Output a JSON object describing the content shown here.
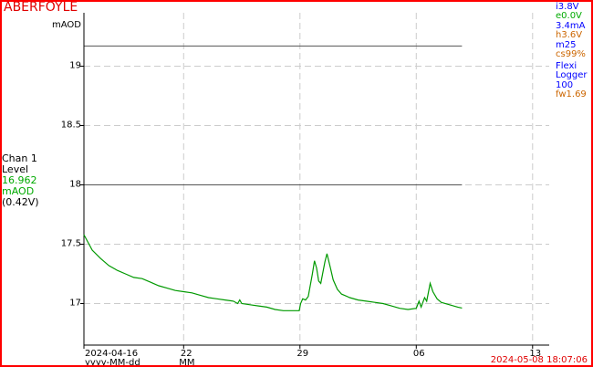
{
  "header": {
    "site_name": "ABERFOYLE"
  },
  "channel": {
    "name": "Chan 1",
    "param": "Level",
    "value": "16.962",
    "unit": "mAOD",
    "raw": "(0.42V)",
    "value_color": "#00aa00"
  },
  "status": [
    {
      "text": "i3.8V",
      "color": "#0000ff"
    },
    {
      "text": "e0.0V",
      "color": "#00aa00"
    },
    {
      "text": "3.4mA",
      "color": "#0000ff"
    },
    {
      "text": "h3.6V",
      "color": "#cc6600"
    },
    {
      "text": "m25",
      "color": "#0000ff"
    },
    {
      "text": "cs99%",
      "color": "#cc6600"
    }
  ],
  "logger": {
    "line1": "Flexi",
    "line2": "Logger",
    "line3": "100",
    "firmware": "fw1.69",
    "firmware_color": "#cc6600"
  },
  "timestamp": "2024-05-08 18:07:06",
  "chart_data": {
    "type": "line",
    "y_unit_label": "mAOD",
    "ylim": [
      16.65,
      19.45
    ],
    "y_ticks": [
      17,
      17.5,
      18,
      18.5,
      19
    ],
    "y_tick_labels": [
      "17",
      "17.5",
      "18",
      "18.5",
      "19"
    ],
    "xlim": [
      "2024-04-16",
      "2024-05-14"
    ],
    "x_ticks": [
      "2024-04-16",
      "2024-04-22",
      "2024-04-29",
      "2024-05-06",
      "2024-05-13"
    ],
    "x_tick_labels": [
      "2024-04-16",
      "22",
      "29",
      "06",
      "13"
    ],
    "x_format_labels": [
      "yyyy-MM-dd",
      "MM"
    ],
    "grid": true,
    "threshold_lines": [
      19.17,
      18.0
    ],
    "series": [
      {
        "color": "#009900",
        "points": [
          [
            "2024-04-16 00:00",
            17.58
          ],
          [
            "2024-04-16 12:00",
            17.45
          ],
          [
            "2024-04-17 00:00",
            17.38
          ],
          [
            "2024-04-17 12:00",
            17.32
          ],
          [
            "2024-04-18 00:00",
            17.28
          ],
          [
            "2024-04-18 12:00",
            17.25
          ],
          [
            "2024-04-19 00:00",
            17.22
          ],
          [
            "2024-04-19 12:00",
            17.21
          ],
          [
            "2024-04-20 00:00",
            17.18
          ],
          [
            "2024-04-20 12:00",
            17.15
          ],
          [
            "2024-04-21 00:00",
            17.13
          ],
          [
            "2024-04-21 12:00",
            17.11
          ],
          [
            "2024-04-22 00:00",
            17.1
          ],
          [
            "2024-04-22 12:00",
            17.09
          ],
          [
            "2024-04-23 00:00",
            17.07
          ],
          [
            "2024-04-23 12:00",
            17.05
          ],
          [
            "2024-04-24 00:00",
            17.04
          ],
          [
            "2024-04-24 12:00",
            17.03
          ],
          [
            "2024-04-25 00:00",
            17.02
          ],
          [
            "2024-04-25 06:00",
            17.0
          ],
          [
            "2024-04-25 09:00",
            17.03
          ],
          [
            "2024-04-25 12:00",
            17.0
          ],
          [
            "2024-04-26 00:00",
            16.99
          ],
          [
            "2024-04-26 12:00",
            16.98
          ],
          [
            "2024-04-27 00:00",
            16.97
          ],
          [
            "2024-04-27 12:00",
            16.95
          ],
          [
            "2024-04-28 00:00",
            16.94
          ],
          [
            "2024-04-28 12:00",
            16.94
          ],
          [
            "2024-04-28 23:00",
            16.94
          ],
          [
            "2024-04-29 01:00",
            17.0
          ],
          [
            "2024-04-29 04:00",
            17.04
          ],
          [
            "2024-04-29 08:00",
            17.03
          ],
          [
            "2024-04-29 12:00",
            17.06
          ],
          [
            "2024-04-29 18:00",
            17.25
          ],
          [
            "2024-04-29 21:00",
            17.36
          ],
          [
            "2024-04-30 00:00",
            17.3
          ],
          [
            "2024-04-30 03:00",
            17.19
          ],
          [
            "2024-04-30 06:00",
            17.17
          ],
          [
            "2024-04-30 12:00",
            17.35
          ],
          [
            "2024-04-30 15:00",
            17.42
          ],
          [
            "2024-04-30 20:00",
            17.3
          ],
          [
            "2024-05-01 00:00",
            17.2
          ],
          [
            "2024-05-01 06:00",
            17.12
          ],
          [
            "2024-05-01 12:00",
            17.08
          ],
          [
            "2024-05-02 00:00",
            17.05
          ],
          [
            "2024-05-02 12:00",
            17.03
          ],
          [
            "2024-05-03 00:00",
            17.02
          ],
          [
            "2024-05-03 12:00",
            17.01
          ],
          [
            "2024-05-04 00:00",
            17.0
          ],
          [
            "2024-05-04 12:00",
            16.98
          ],
          [
            "2024-05-05 00:00",
            16.96
          ],
          [
            "2024-05-05 12:00",
            16.95
          ],
          [
            "2024-05-06 00:00",
            16.96
          ],
          [
            "2024-05-06 04:00",
            17.02
          ],
          [
            "2024-05-06 07:00",
            16.97
          ],
          [
            "2024-05-06 12:00",
            17.05
          ],
          [
            "2024-05-06 15:00",
            17.02
          ],
          [
            "2024-05-06 20:00",
            17.17
          ],
          [
            "2024-05-07 00:00",
            17.1
          ],
          [
            "2024-05-07 06:00",
            17.04
          ],
          [
            "2024-05-07 12:00",
            17.01
          ],
          [
            "2024-05-08 00:00",
            16.99
          ],
          [
            "2024-05-08 12:00",
            16.97
          ],
          [
            "2024-05-08 18:00",
            16.962
          ]
        ]
      }
    ]
  }
}
